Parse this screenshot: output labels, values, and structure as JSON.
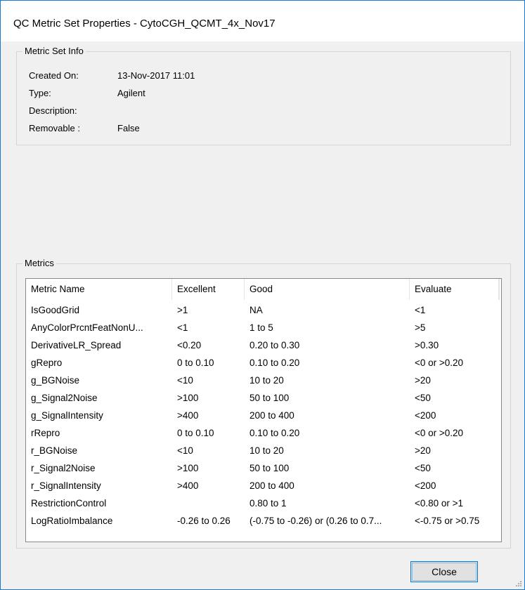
{
  "window": {
    "title": "QC Metric Set Properties - CytoCGH_QCMT_4x_Nov17"
  },
  "info": {
    "group_label": "Metric Set Info",
    "rows": [
      {
        "key": "Created On:",
        "value": "13-Nov-2017 11:01"
      },
      {
        "key": "Type:",
        "value": "Agilent"
      },
      {
        "key": "Description:",
        "value": ""
      },
      {
        "key": "Removable :",
        "value": "False"
      }
    ]
  },
  "metrics": {
    "group_label": "Metrics",
    "columns": [
      "Metric Name",
      "Excellent",
      "Good",
      "Evaluate"
    ],
    "rows": [
      [
        "IsGoodGrid",
        ">1",
        "NA",
        "<1"
      ],
      [
        "AnyColorPrcntFeatNonU...",
        "<1",
        "1 to 5",
        ">5"
      ],
      [
        "DerivativeLR_Spread",
        "<0.20",
        "0.20 to 0.30",
        ">0.30"
      ],
      [
        "gRepro",
        "0 to 0.10",
        "0.10 to 0.20",
        "<0 or >0.20"
      ],
      [
        "g_BGNoise",
        "<10",
        "10 to 20",
        ">20"
      ],
      [
        "g_Signal2Noise",
        ">100",
        "50 to 100",
        "<50"
      ],
      [
        "g_SignalIntensity",
        ">400",
        "200 to 400",
        "<200"
      ],
      [
        "rRepro",
        "0 to 0.10",
        "0.10 to 0.20",
        "<0 or >0.20"
      ],
      [
        "r_BGNoise",
        "<10",
        "10 to 20",
        ">20"
      ],
      [
        "r_Signal2Noise",
        ">100",
        "50 to 100",
        "<50"
      ],
      [
        "r_SignalIntensity",
        ">400",
        "200 to 400",
        "<200"
      ],
      [
        "RestrictionControl",
        "",
        "0.80 to 1",
        "<0.80 or >1"
      ],
      [
        "LogRatioImbalance",
        "-0.26 to 0.26",
        "(-0.75 to -0.26) or (0.26 to 0.7...",
        "<-0.75 or >0.75"
      ]
    ]
  },
  "buttons": {
    "close_label": "Close"
  },
  "colors": {
    "window_border": "#1a78d6",
    "accent": "#0078d7",
    "dialog_bg": "#f0f0f0"
  }
}
